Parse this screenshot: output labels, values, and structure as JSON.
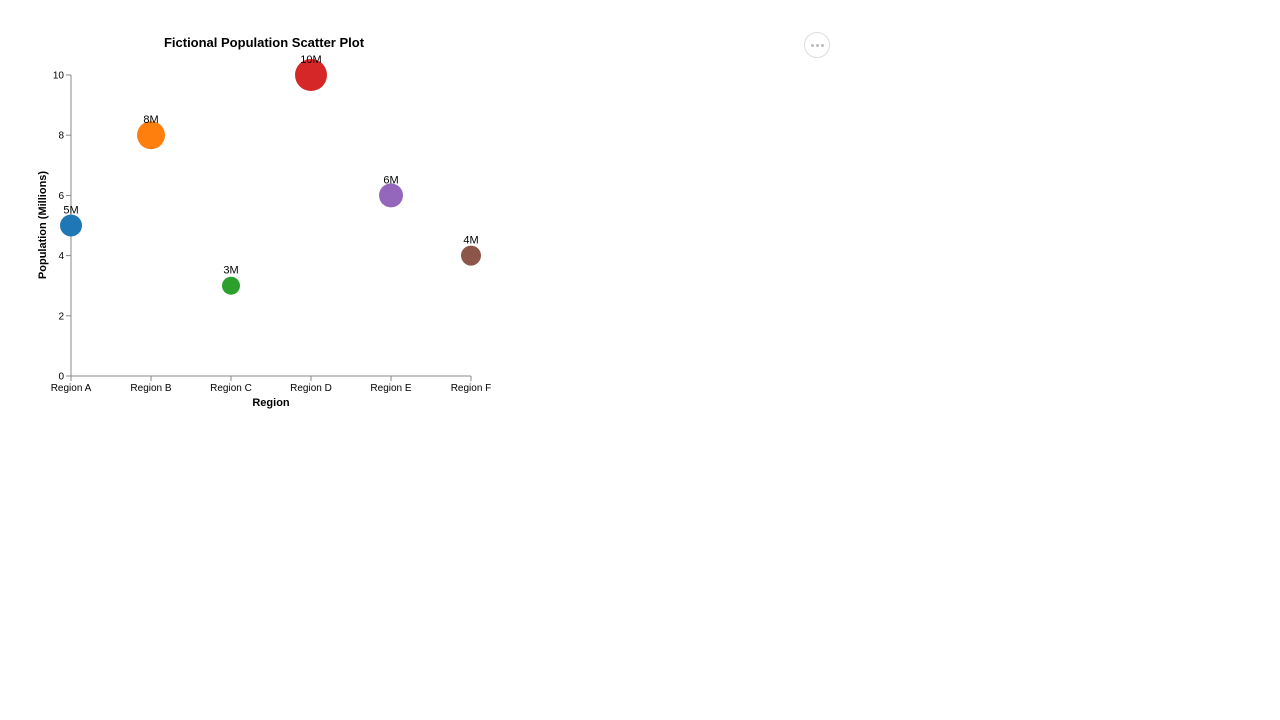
{
  "actions_menu": {
    "icon": "more-horizontal-icon"
  },
  "chart_data": {
    "type": "scatter",
    "title": "Fictional Population Scatter Plot",
    "xlabel": "Region",
    "ylabel": "Population (Millions)",
    "categories": [
      "Region A",
      "Region B",
      "Region C",
      "Region D",
      "Region E",
      "Region F"
    ],
    "values": [
      5,
      8,
      3,
      10,
      6,
      4
    ],
    "labels": [
      "5M",
      "8M",
      "3M",
      "10M",
      "6M",
      "4M"
    ],
    "colors": [
      "#1f77b4",
      "#ff7f0e",
      "#2ca02c",
      "#d62728",
      "#9467bd",
      "#8c564b"
    ],
    "size_encoded_by": "value",
    "ylim": [
      0,
      10
    ],
    "yticks": [
      0,
      2,
      4,
      6,
      8,
      10
    ],
    "grid": false,
    "legend": "none"
  }
}
